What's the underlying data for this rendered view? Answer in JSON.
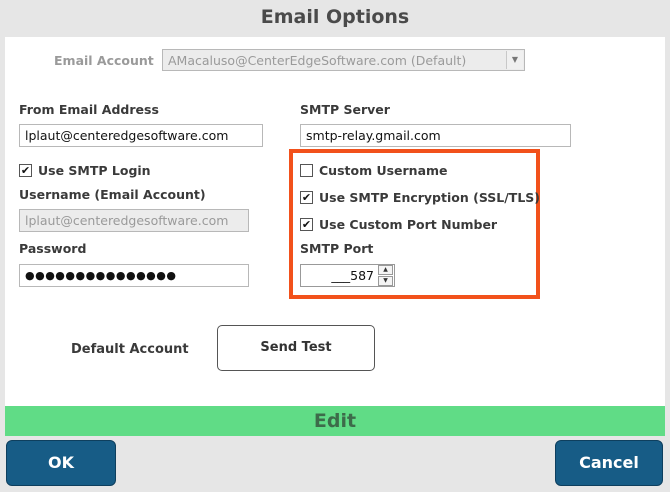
{
  "window": {
    "title": "Email Options"
  },
  "account": {
    "label": "Email Account",
    "value": "AMacaluso@CenterEdgeSoftware.com (Default)"
  },
  "from": {
    "label": "From Email Address",
    "value": "lplaut@centeredgesoftware.com"
  },
  "smtp_server": {
    "label": "SMTP Server",
    "value": "smtp-relay.gmail.com"
  },
  "use_smtp_login": {
    "label": "Use SMTP Login",
    "checked": true
  },
  "username": {
    "label": "Username (Email Account)",
    "value": "lplaut@centeredgesoftware.com"
  },
  "password": {
    "label": "Password",
    "value": "●●●●●●●●●●●●●●●"
  },
  "custom_username": {
    "label": "Custom Username",
    "checked": false
  },
  "encryption": {
    "label": "Use SMTP Encryption (SSL/TLS)",
    "checked": true
  },
  "custom_port": {
    "label": "Use Custom Port Number",
    "checked": true
  },
  "smtp_port": {
    "label": "SMTP Port",
    "value": "___587"
  },
  "default_account": {
    "label": "Default Account"
  },
  "send_test": {
    "label": "Send Test"
  },
  "edit_bar": {
    "label": "Edit"
  },
  "buttons": {
    "ok": "OK",
    "cancel": "Cancel"
  },
  "icons": {
    "dropdown": "chevron-down-icon",
    "check": "checkmark-icon",
    "spin_up": "spin-up-icon",
    "spin_down": "spin-down-icon"
  },
  "colors": {
    "highlight": "#f2511b",
    "edit_bar": "#60dc86",
    "primary_button": "#175c86"
  }
}
